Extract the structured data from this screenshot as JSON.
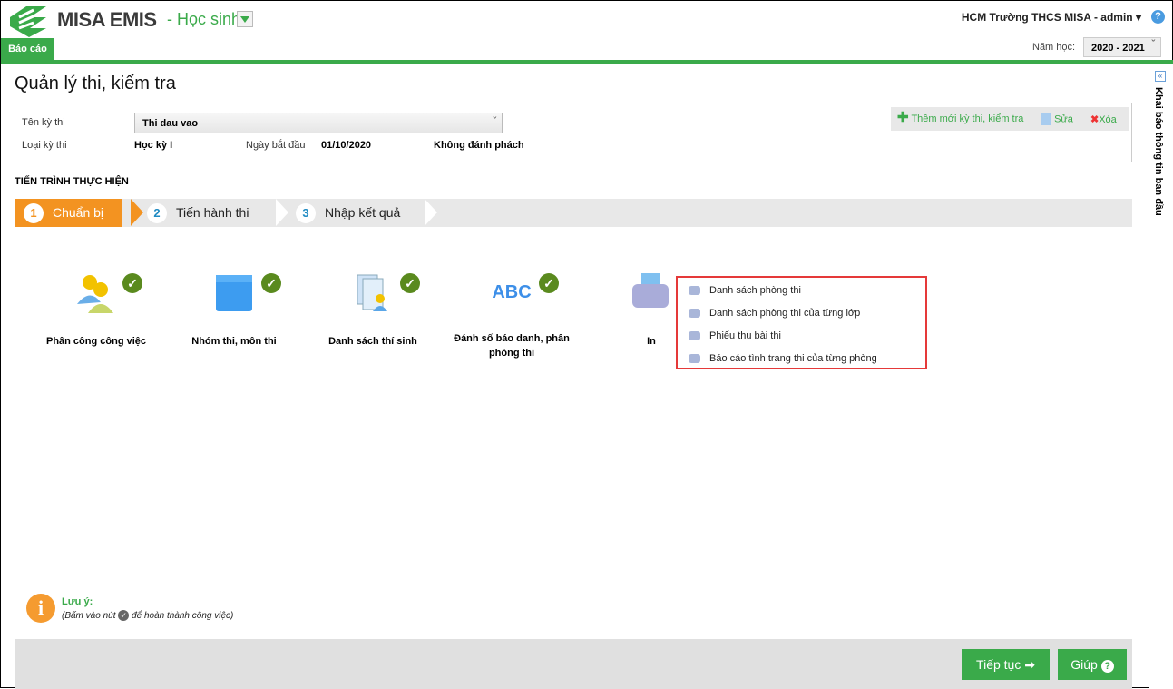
{
  "header": {
    "app_name": "MISA EMIS",
    "module": "- Học sinh",
    "user": "HCM Trường THCS MISA - admin ▾",
    "help_icon": "?",
    "tab": "Báo cáo",
    "year_label": "Năm học:",
    "year_value": "2020 - 2021"
  },
  "sidebar": {
    "collapse": "«",
    "title": "Khai báo thông tin ban đầu"
  },
  "page": {
    "title": "Quản lý thi, kiểm tra"
  },
  "info": {
    "name_label": "Tên kỳ thi",
    "name_value": "Thi dau vao",
    "type_label": "Loại kỳ thi",
    "type_value": "Học kỳ I",
    "date_label": "Ngày bắt đầu",
    "date_value": "01/10/2020",
    "mode_value": "Không đánh phách"
  },
  "toolbar": {
    "add": "Thêm mới kỳ thi, kiểm tra",
    "edit": "Sửa",
    "delete": "Xóa"
  },
  "progress": {
    "title": "TIẾN TRÌNH THỰC HIỆN",
    "steps": [
      {
        "n": "1",
        "label": "Chuẩn bị"
      },
      {
        "n": "2",
        "label": "Tiến hành thi"
      },
      {
        "n": "3",
        "label": "Nhập kết quả"
      }
    ]
  },
  "tasks": [
    "Phân công công việc",
    "Nhóm thi, môn thi",
    "Danh sách thí sinh",
    "Đánh số báo danh, phân phòng thi",
    "In"
  ],
  "print_menu": [
    "Danh sách phòng thi",
    "Danh sách phòng thi của từng lớp",
    "Phiếu thu bài thi",
    "Báo cáo tình trạng thi của từng phòng"
  ],
  "note": {
    "title": "Lưu ý:",
    "text_before": "(Bấm vào nút",
    "text_after": "để hoàn thành công việc)"
  },
  "footer": {
    "next": "Tiếp tục",
    "help": "Giúp"
  },
  "colors": {
    "green": "#3aaa4a",
    "orange": "#f39321"
  }
}
